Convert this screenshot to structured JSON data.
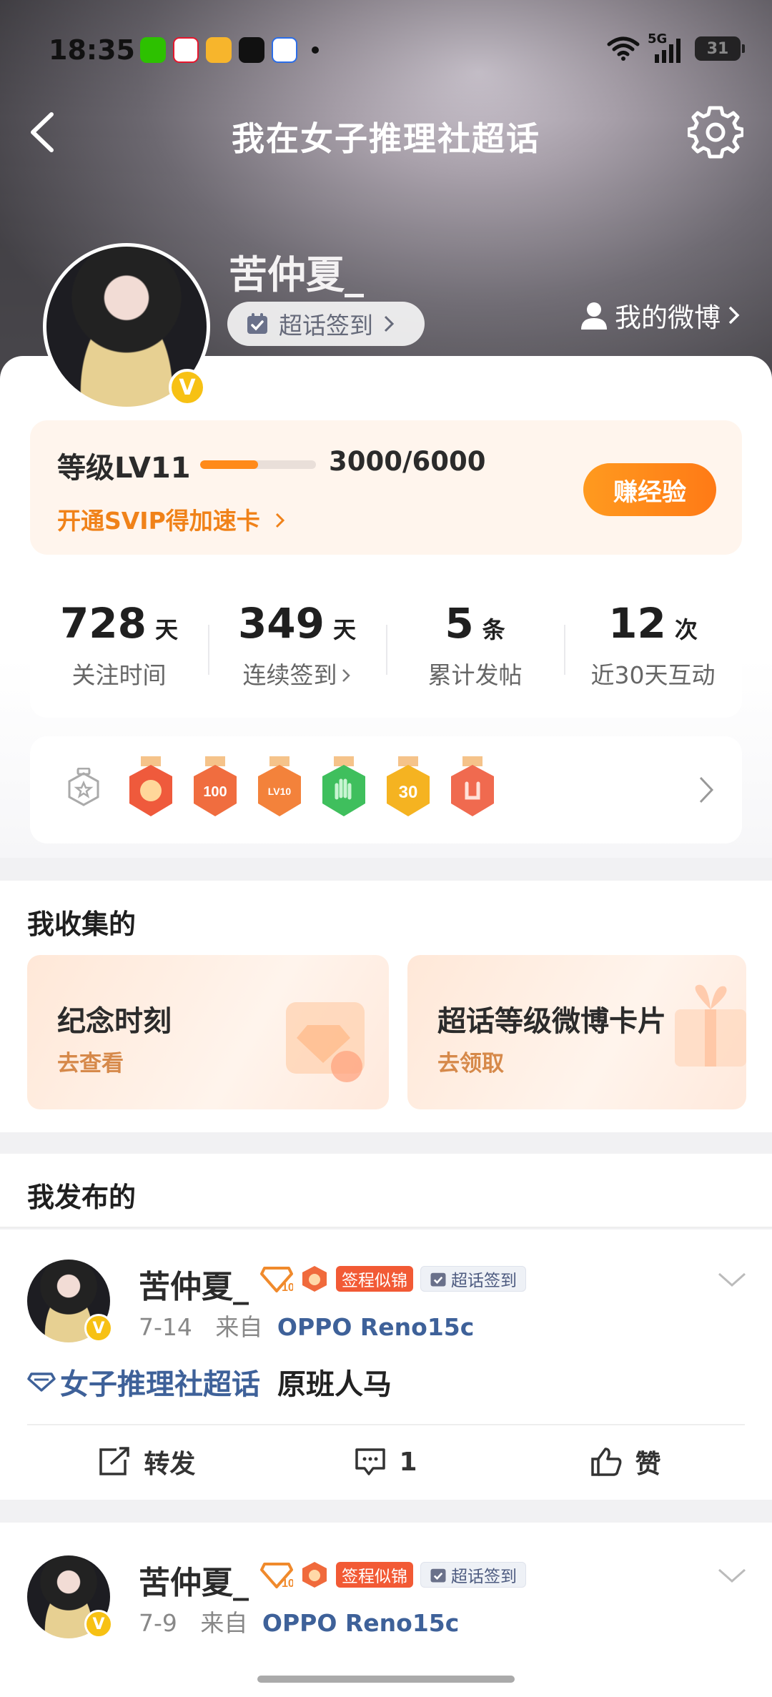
{
  "status_bar": {
    "time": "18:35",
    "network": "5G",
    "battery": "31",
    "app_icons": [
      "wechat-icon",
      "weibo-icon",
      "reader-icon",
      "tiktok-icon",
      "baidu-icon"
    ]
  },
  "nav": {
    "title": "我在女子推理社超话"
  },
  "profile": {
    "username": "苦仲夏_",
    "checkin_label": "超话签到",
    "my_weibo_label": "我的微博",
    "verified_mark": "V"
  },
  "level": {
    "label": "等级LV11",
    "progress_text": "3000/6000",
    "progress_fraction": 0.5,
    "svip_link": "开通SVIP得加速卡",
    "earn_button": "赚经验"
  },
  "stats": [
    {
      "num": "728",
      "unit": "天",
      "label": "关注时间"
    },
    {
      "num": "349",
      "unit": "天",
      "label": "连续签到",
      "has_arrow": true
    },
    {
      "num": "5",
      "unit": "条",
      "label": "累计发帖"
    },
    {
      "num": "12",
      "unit": "次",
      "label": "近30天互动"
    }
  ],
  "badges": {
    "items": [
      {
        "name": "badge-mascot",
        "color": "#ef5a3c"
      },
      {
        "name": "badge-100-days",
        "color": "#f06d3f",
        "text": "100"
      },
      {
        "name": "badge-lv10",
        "color": "#f3823b",
        "text": "LV10"
      },
      {
        "name": "badge-green-hand",
        "color": "#3fbf5d"
      },
      {
        "name": "badge-30-days",
        "color": "#f5b321",
        "text": "30"
      },
      {
        "name": "badge-rock-hand",
        "color": "#f06a4f"
      }
    ]
  },
  "collections": {
    "title": "我收集的",
    "cards": [
      {
        "title": "纪念时刻",
        "sub": "去查看"
      },
      {
        "title": "超话等级微博卡片",
        "sub": "去领取"
      }
    ]
  },
  "posts_section": {
    "title": "我发布的"
  },
  "posts": [
    {
      "username": "苦仲夏_",
      "level_badge": "10",
      "tag_red": "签程似锦",
      "tag_check": "超话签到",
      "date": "7-14",
      "from_label": "来自",
      "device": "OPPO Reno15c",
      "topic": "女子推理社超话",
      "text": "原班人马",
      "repost_label": "转发",
      "comment_count": "1",
      "like_label": "赞"
    },
    {
      "username": "苦仲夏_",
      "level_badge": "10",
      "tag_red": "签程似锦",
      "tag_check": "超话签到",
      "date": "7-9",
      "from_label": "来自",
      "device": "OPPO Reno15c"
    }
  ]
}
